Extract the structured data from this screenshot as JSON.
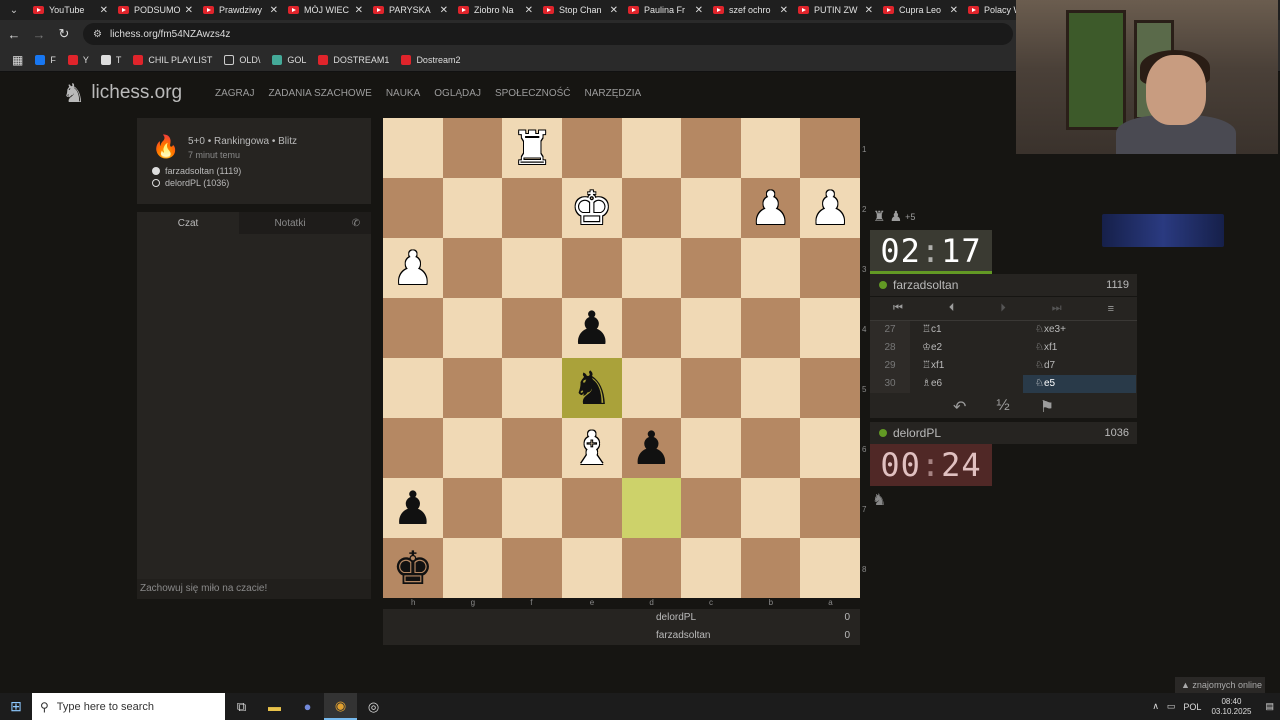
{
  "browser": {
    "tabs": [
      "YouTube",
      "PODSUMO",
      "Prawdziwy",
      "MÓJ WIEC",
      "PARYSKA",
      "Ziobro Na",
      "Stop Chan",
      "Paulina Fr",
      "szef ochro",
      "PUTIN ZW",
      "Cupra Leo",
      "Polacy W"
    ],
    "url": "lichess.org/fm54NZAwzs4z",
    "bookmarks": [
      "F",
      "Y",
      "T",
      "CHIL PLAYLIST",
      "OLD\\",
      "GOL",
      "DOSTREAM1",
      "Dostream2"
    ]
  },
  "lichess": {
    "logo": "lichess.org",
    "menu": [
      "ZAGRAJ",
      "ZADANIA SZACHOWE",
      "NAUKA",
      "OGLĄDAJ",
      "SPOŁECZNOŚĆ",
      "NARZĘDZIA"
    ],
    "game_title": "5+0 • Rankingowa • Blitz",
    "game_time": "7 minut temu",
    "player_white": "farzadsoltan (1119)",
    "player_black": "delordPL (1036)",
    "chat_tab": "Czat",
    "notes_tab": "Notatki",
    "chat_footer": "Zachowuj się miło na czacie!",
    "score_rows": [
      {
        "name": "delordPL",
        "score": "0"
      },
      {
        "name": "farzadsoltan",
        "score": "0"
      }
    ],
    "files": [
      "h",
      "g",
      "f",
      "e",
      "d",
      "c",
      "b",
      "a"
    ],
    "ranks": [
      "1",
      "2",
      "3",
      "4",
      "5",
      "6",
      "7",
      "8"
    ],
    "board": [
      [
        "",
        "",
        "wR",
        "",
        "",
        "",
        "",
        ""
      ],
      [
        "",
        "",
        "",
        "wK",
        "",
        "",
        "wP",
        "wP"
      ],
      [
        "wP",
        "",
        "",
        "",
        "",
        "",
        "",
        ""
      ],
      [
        "",
        "",
        "",
        "bP",
        "",
        "",
        "",
        ""
      ],
      [
        "",
        "",
        "",
        "bN",
        "",
        "",
        "",
        ""
      ],
      [
        "",
        "",
        "",
        "wB",
        "bP",
        "",
        "",
        ""
      ],
      [
        "bP",
        "",
        "",
        "",
        "",
        "",
        "",
        ""
      ],
      [
        "bK",
        "",
        "",
        "",
        "",
        "",
        "",
        ""
      ]
    ],
    "highlights": [
      "4-3",
      "6-4"
    ],
    "captured": "+5",
    "clock_top": {
      "min": "02",
      "sec": "17"
    },
    "clock_bottom": {
      "min": "00",
      "sec": "24"
    },
    "top_player": {
      "name": "farzadsoltan",
      "rating": "1119"
    },
    "bottom_player": {
      "name": "delordPL",
      "rating": "1036"
    },
    "moves": [
      {
        "num": "27",
        "white": "♖c1",
        "black": "♘xe3+"
      },
      {
        "num": "28",
        "white": "♔e2",
        "black": "♘xf1"
      },
      {
        "num": "29",
        "white": "♖xf1",
        "black": "♘d7"
      },
      {
        "num": "30",
        "white": "♗e6",
        "black": "♘e5"
      }
    ],
    "friends_online": "znajomych online"
  },
  "taskbar": {
    "search_placeholder": "Type here to search",
    "lang": "POL",
    "time": "08:40",
    "date": "03.10.2025"
  }
}
